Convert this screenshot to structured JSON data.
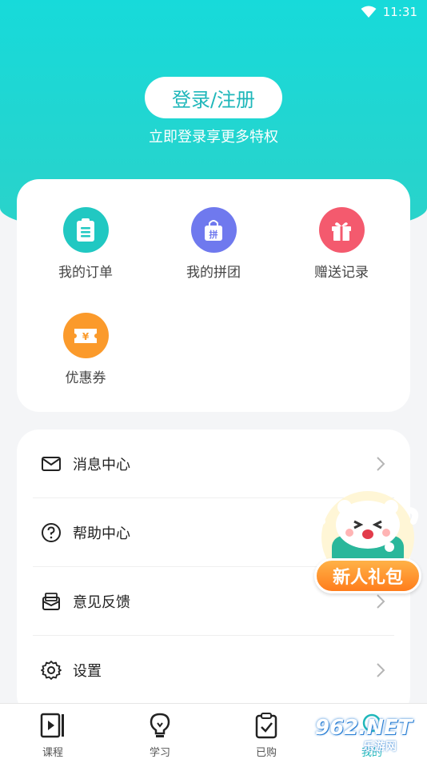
{
  "status_bar": {
    "time": "11:31"
  },
  "header": {
    "login_label": "登录/注册",
    "subtitle": "立即登录享更多特权"
  },
  "quick_actions": [
    {
      "label": "我的订单",
      "icon": "clipboard-icon",
      "color": "#21c8c2"
    },
    {
      "label": "我的拼团",
      "icon": "shopping-bag-icon",
      "color": "#6f79ee"
    },
    {
      "label": "赠送记录",
      "icon": "gift-icon",
      "color": "#f45a6e"
    },
    {
      "label": "优惠券",
      "icon": "coupon-icon",
      "color": "#fb9a2b"
    }
  ],
  "menu": [
    {
      "label": "消息中心",
      "icon": "mail-icon"
    },
    {
      "label": "帮助中心",
      "icon": "help-icon"
    },
    {
      "label": "意见反馈",
      "icon": "feedback-icon"
    },
    {
      "label": "设置",
      "icon": "gear-icon"
    }
  ],
  "tabs": [
    {
      "label": "课程",
      "icon": "play-icon"
    },
    {
      "label": "学习",
      "icon": "lightbulb-icon"
    },
    {
      "label": "已购",
      "icon": "purchased-icon"
    },
    {
      "label": "我的",
      "icon": "profile-icon"
    }
  ],
  "promo": {
    "label": "新人礼包"
  },
  "watermark": {
    "text": "962.NET",
    "sub": "乐游网"
  },
  "colors": {
    "accent": "#1fb7ba",
    "hero": "#17dada"
  }
}
